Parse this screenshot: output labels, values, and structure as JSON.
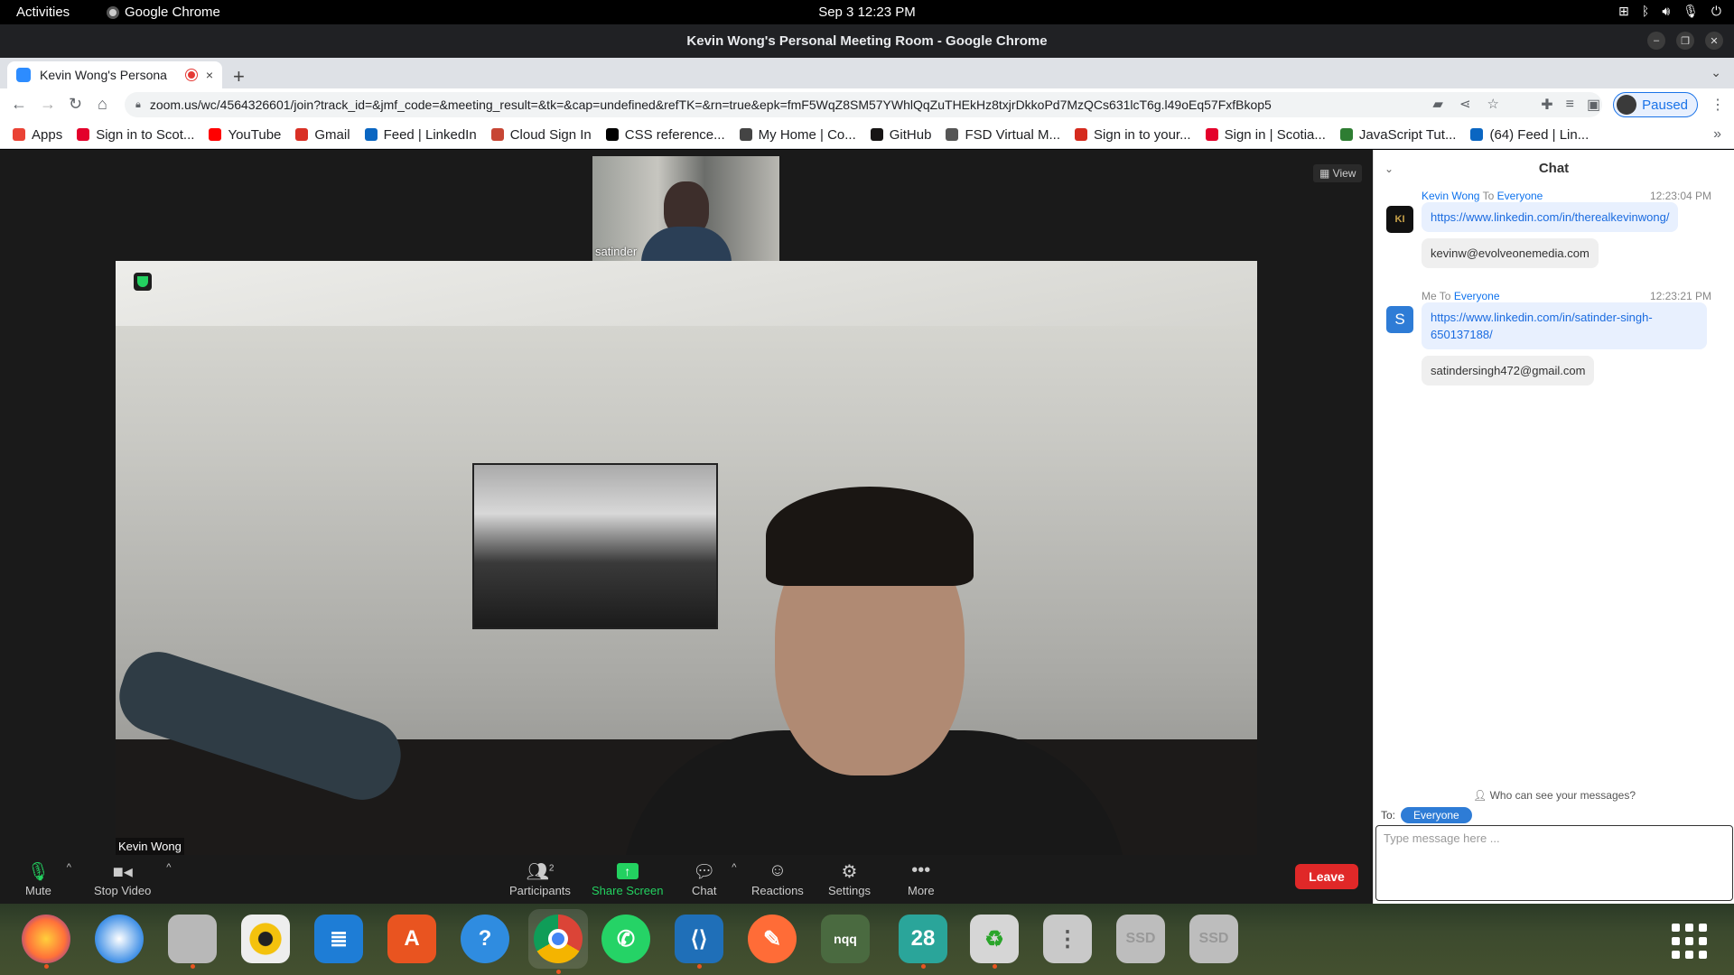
{
  "topbar": {
    "activities": "Activities",
    "app": "Google Chrome",
    "clock": "Sep 3  12:23 PM",
    "tray_icons": [
      "network-icon",
      "bluetooth-icon",
      "volume-icon",
      "microphone-icon",
      "power-icon"
    ]
  },
  "window": {
    "title": "Kevin Wong's Personal Meeting Room - Google Chrome"
  },
  "tab": {
    "title": "Kevin Wong's Persona",
    "new_tab": "+",
    "close": "×"
  },
  "toolbar": {
    "url": "zoom.us/wc/4564326601/join?track_id=&jmf_code=&meeting_result=&tk=&cap=undefined&refTK=&rn=true&epk=fmF5WqZ8SM57YWhlQqZuTHEkHz8txjrDkkoPd7MzQCs631lcT6g.l49oEq57FxfBkop5",
    "profile_status": "Paused"
  },
  "bookmarks": [
    {
      "label": "Apps",
      "color": "#ea4335"
    },
    {
      "label": "Sign in to Scot...",
      "color": "#e4002b"
    },
    {
      "label": "YouTube",
      "color": "#ff0000"
    },
    {
      "label": "Gmail",
      "color": "#d93025"
    },
    {
      "label": "Feed | LinkedIn",
      "color": "#0a66c2"
    },
    {
      "label": "Cloud Sign In",
      "color": "#c74634"
    },
    {
      "label": "CSS reference...",
      "color": "#000000"
    },
    {
      "label": "My Home | Co...",
      "color": "#444444"
    },
    {
      "label": "GitHub",
      "color": "#171515"
    },
    {
      "label": "FSD Virtual M...",
      "color": "#555555"
    },
    {
      "label": "Sign in to your...",
      "color": "#d52b1e"
    },
    {
      "label": "Sign in | Scotia...",
      "color": "#e4002b"
    },
    {
      "label": "JavaScript Tut...",
      "color": "#2e7d32"
    },
    {
      "label": "(64) Feed | Lin...",
      "color": "#0a66c2"
    }
  ],
  "meeting": {
    "thumbnail_name": "satinder",
    "view_label": "View",
    "speaker_name": "Kevin Wong"
  },
  "controls": {
    "mute": "Mute",
    "stop_video": "Stop Video",
    "participants": "Participants",
    "participant_count": "2",
    "share_screen": "Share Screen",
    "chat": "Chat",
    "reactions": "Reactions",
    "settings": "Settings",
    "more": "More",
    "leave": "Leave"
  },
  "chat": {
    "title": "Chat",
    "messages": [
      {
        "sender": "Kevin Wong",
        "to_label": "To",
        "recipient": "Everyone",
        "time": "12:23:04 PM",
        "lines": [
          "https://www.linkedin.com/in/therealkevinwong/",
          "kevinw@evolveonemedia.com"
        ]
      },
      {
        "sender": "Me",
        "to_label": "To",
        "recipient": "Everyone",
        "time": "12:23:21 PM",
        "avatar_letter": "S",
        "lines": [
          "https://www.linkedin.com/in/satinder-singh-650137188/",
          "satindersingh472@gmail.com"
        ]
      }
    ],
    "who_can_see": "Who can see your messages?",
    "to_label": "To:",
    "to_value": "Everyone",
    "input_placeholder": "Type message here ..."
  },
  "dock": {
    "apps": [
      "firefox-icon",
      "thunderbird-icon",
      "files-icon",
      "rhythmbox-icon",
      "libreoffice-writer-icon",
      "software-icon",
      "help-icon",
      "chrome-icon",
      "whatsapp-icon",
      "vscode-icon",
      "postman-icon",
      "nqq-icon",
      "calendar-icon",
      "trash-icon",
      "drive-icon",
      "ssd-icon",
      "ssd-icon"
    ],
    "nqq_label": "nqq",
    "calendar_day": "28",
    "ssd_label": "SSD"
  }
}
